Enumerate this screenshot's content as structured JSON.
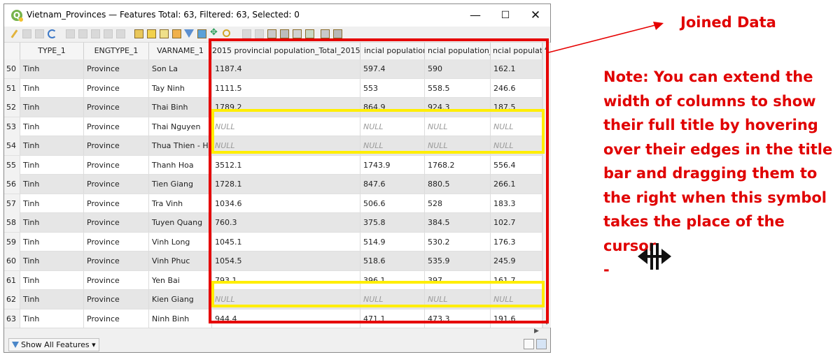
{
  "window": {
    "title": "Vietnam_Provinces — Features Total: 63, Filtered: 63, Selected: 0",
    "app_icon": "Q",
    "minimize": "—",
    "maximize": "☐",
    "close": "✕"
  },
  "table": {
    "headers": [
      "TYPE_1",
      "ENGTYPE_1",
      "VARNAME_1",
      "2015 provincial population_Total_2015",
      "incial population_N",
      "ncial population_Fe",
      "ncial populati"
    ],
    "rows": [
      {
        "n": "50",
        "type": "Tinh",
        "eng": "Province",
        "var": "Son La",
        "c1": "1187.4",
        "c2": "597.4",
        "c3": "590",
        "c4": "162.1"
      },
      {
        "n": "51",
        "type": "Tinh",
        "eng": "Province",
        "var": "Tay Ninh",
        "c1": "1111.5",
        "c2": "553",
        "c3": "558.5",
        "c4": "246.6"
      },
      {
        "n": "52",
        "type": "Tinh",
        "eng": "Province",
        "var": "Thai Binh",
        "c1": "1789.2",
        "c2": "864.9",
        "c3": "924.3",
        "c4": "187.5"
      },
      {
        "n": "53",
        "type": "Tinh",
        "eng": "Province",
        "var": "Thai Nguyen",
        "c1": "NULL",
        "c2": "NULL",
        "c3": "NULL",
        "c4": "NULL"
      },
      {
        "n": "54",
        "type": "Tinh",
        "eng": "Province",
        "var": "Thua Thien - Hue",
        "c1": "NULL",
        "c2": "NULL",
        "c3": "NULL",
        "c4": "NULL"
      },
      {
        "n": "55",
        "type": "Tinh",
        "eng": "Province",
        "var": "Thanh Hoa",
        "c1": "3512.1",
        "c2": "1743.9",
        "c3": "1768.2",
        "c4": "556.4"
      },
      {
        "n": "56",
        "type": "Tinh",
        "eng": "Province",
        "var": "Tien Giang",
        "c1": "1728.1",
        "c2": "847.6",
        "c3": "880.5",
        "c4": "266.1"
      },
      {
        "n": "57",
        "type": "Tinh",
        "eng": "Province",
        "var": "Tra Vinh",
        "c1": "1034.6",
        "c2": "506.6",
        "c3": "528",
        "c4": "183.3"
      },
      {
        "n": "58",
        "type": "Tinh",
        "eng": "Province",
        "var": "Tuyen Quang",
        "c1": "760.3",
        "c2": "375.8",
        "c3": "384.5",
        "c4": "102.7"
      },
      {
        "n": "59",
        "type": "Tinh",
        "eng": "Province",
        "var": "Vinh Long",
        "c1": "1045.1",
        "c2": "514.9",
        "c3": "530.2",
        "c4": "176.3"
      },
      {
        "n": "60",
        "type": "Tinh",
        "eng": "Province",
        "var": "Vinh Phuc",
        "c1": "1054.5",
        "c2": "518.6",
        "c3": "535.9",
        "c4": "245.9"
      },
      {
        "n": "61",
        "type": "Tinh",
        "eng": "Province",
        "var": "Yen Bai",
        "c1": "793.1",
        "c2": "396.1",
        "c3": "397",
        "c4": "161.7"
      },
      {
        "n": "62",
        "type": "Tinh",
        "eng": "Province",
        "var": "Kien Giang",
        "c1": "NULL",
        "c2": "NULL",
        "c3": "NULL",
        "c4": "NULL"
      },
      {
        "n": "63",
        "type": "Tinh",
        "eng": "Province",
        "var": "Ninh Binh",
        "c1": "944.4",
        "c2": "471.1",
        "c3": "473.3",
        "c4": "191.6"
      }
    ]
  },
  "status": {
    "show_all": "Show All Features"
  },
  "annotations": {
    "joined": "Joined Data",
    "note_lines": [
      "Note: You can extend the",
      "width of columns to show",
      "their full title by hovering",
      "over their edges in the title",
      "bar and dragging them to",
      "the right when this symbol",
      "takes the place of the cursor",
      "-"
    ],
    "red": "#e60000",
    "yellow": "#ffee00"
  }
}
